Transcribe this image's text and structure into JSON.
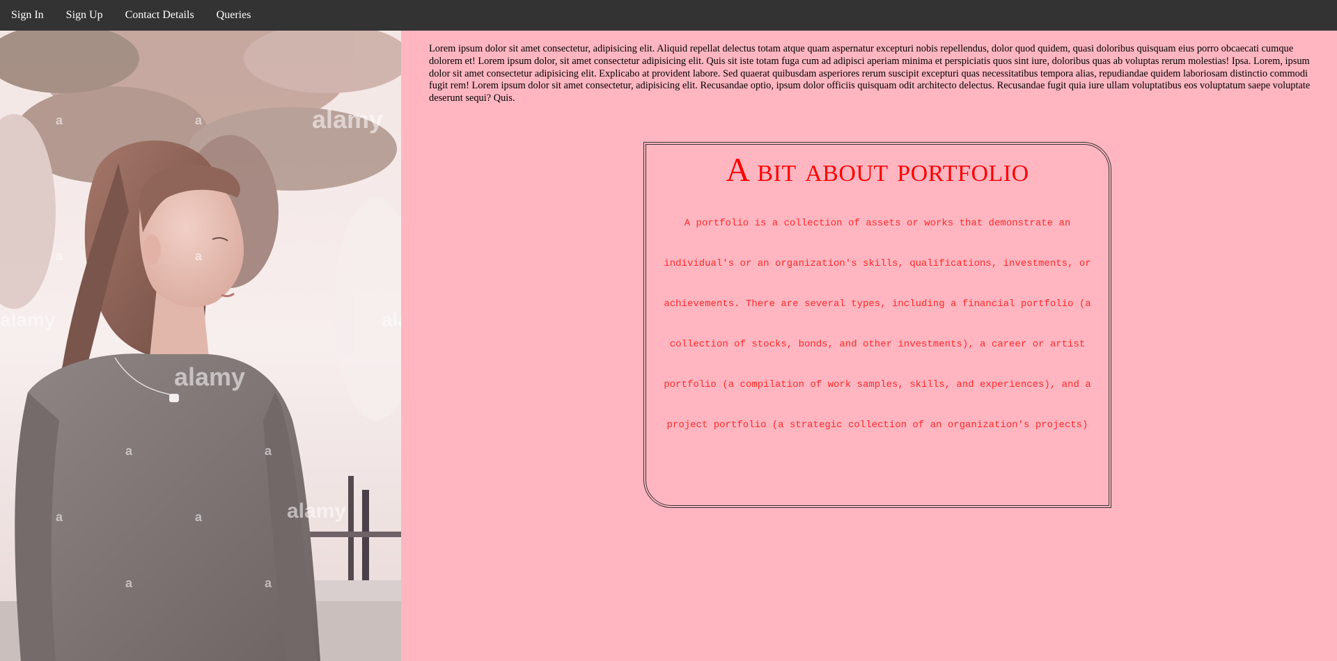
{
  "nav": {
    "items": [
      {
        "label": "Sign In"
      },
      {
        "label": "Sign Up"
      },
      {
        "label": "Contact Details"
      },
      {
        "label": "Queries"
      }
    ]
  },
  "hero": {
    "watermark": "alamy",
    "watermark_letter": "a"
  },
  "intro": {
    "text": "Lorem ipsum dolor sit amet consectetur, adipisicing elit. Aliquid repellat delectus totam atque quam aspernatur excepturi nobis repellendus, dolor quod quidem, quasi doloribus quisquam eius porro obcaecati cumque dolorem et! Lorem ipsum dolor, sit amet consectetur adipisicing elit. Quis sit iste totam fuga cum ad adipisci aperiam minima et perspiciatis quos sint iure, doloribus quas ab voluptas rerum molestias! Ipsa. Lorem, ipsum dolor sit amet consectetur adipisicing elit. Explicabo at provident labore. Sed quaerat quibusdam asperiores rerum suscipit excepturi quas necessitatibus tempora alias, repudiandae quidem laboriosam distinctio commodi fugit rem! Lorem ipsum dolor sit amet consectetur, adipisicing elit. Recusandae optio, ipsum dolor officiis quisquam odit architecto delectus. Recusandae fugit quia iure ullam voluptatibus eos voluptatum saepe voluptate deserunt sequi? Quis."
  },
  "portfolio": {
    "title": "A bit about portfolio",
    "body": "A portfolio is a collection of assets or works that demonstrate an individual's or an organization's skills, qualifications, investments, or achievements. There are several types, including a financial portfolio (a collection of stocks, bonds, and other investments), a career or artist portfolio (a compilation of work samples, skills, and experiences), and a project portfolio (a strategic collection of an organization's projects)"
  },
  "colors": {
    "nav_bg": "#333333",
    "page_bg": "#ffb6c1",
    "accent_red": "#ff0000"
  }
}
